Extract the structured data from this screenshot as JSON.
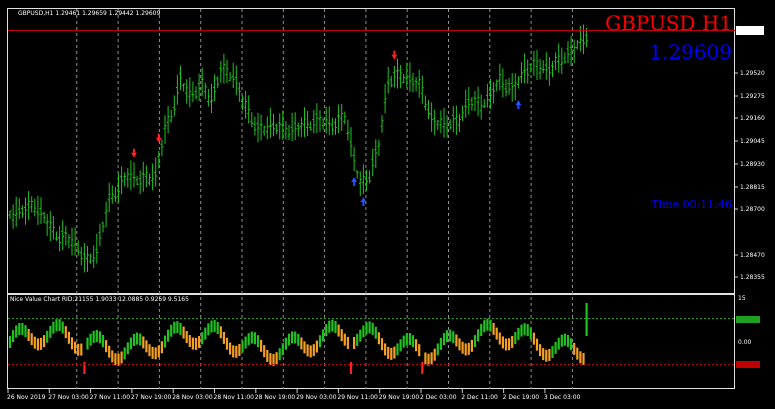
{
  "main_chart": {
    "header": "GBPUSD,H1  1.29461 1.29659 1.29442 1.29609",
    "symbol_label": "GBPUSD  H1",
    "price_label": "1.29609",
    "timer_label": "Time  00:11:46",
    "current_price": "1.29609",
    "price_ticks": [
      "1.29520",
      "1.29275",
      "1.29160",
      "1.29045",
      "1.28930",
      "1.28815",
      "1.28700",
      "1.28470",
      "1.28355"
    ],
    "colors": {
      "bull_bar": "#1fc21f",
      "bear_bar": "#1fc21f",
      "background": "#000000",
      "price_line": "#c00000",
      "symbol_label": "#ff0000",
      "price_label": "#0000ff",
      "timer_label": "#0000ff",
      "sell_arrow": "#ff2020",
      "buy_arrow": "#2050ff"
    },
    "arrows": [
      {
        "type": "sell",
        "bar": 48
      },
      {
        "type": "sell",
        "bar": 40
      },
      {
        "type": "buy",
        "bar": 111
      },
      {
        "type": "buy",
        "bar": 114
      },
      {
        "type": "sell",
        "bar": 124
      },
      {
        "type": "buy",
        "bar": 164
      }
    ]
  },
  "indicator": {
    "header": "Nice Value Chart RID:21155 1.9033 12.0885 0.9259 9.5165",
    "scale_ticks": [
      "15",
      "0.00"
    ],
    "top_badge": "",
    "bottom_badge": "",
    "colors": {
      "up": "#1fc21f",
      "down": "#f5a020",
      "extreme": "#ff2020",
      "upper_level": "#20a020",
      "lower_level": "#c00000"
    }
  },
  "time_axis": [
    "26 Nov 2019",
    "27 Nov 03:00",
    "27 Nov 11:00",
    "27 Nov 19:00",
    "28 Nov 03:00",
    "28 Nov 11:00",
    "28 Nov 19:00",
    "29 Nov 03:00",
    "29 Nov 11:00",
    "29 Nov 19:00",
    "2 Dec 03:00",
    "2 Dec 11:00",
    "2 Dec 19:00",
    "3 Dec 03:00"
  ]
}
